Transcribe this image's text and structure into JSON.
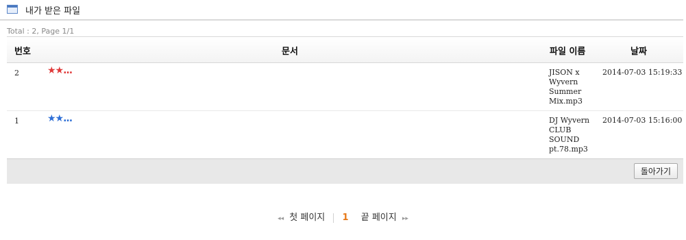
{
  "header": {
    "title": "내가 받은 파일",
    "icon": "window-icon"
  },
  "meta": {
    "total_text": "Total : 2, Page 1/1"
  },
  "table": {
    "columns": [
      "번호",
      "문서",
      "파일 이름",
      "날짜"
    ],
    "rows": [
      {
        "num": "2",
        "doc": "★★...",
        "doc_color": "#e03a3a",
        "file": "JISON x Wyvern Summer Mix.mp3",
        "date": "2014-07-03 15:19:33"
      },
      {
        "num": "1",
        "doc": "★★...",
        "doc_color": "#2f6fd6",
        "file": "DJ Wyvern CLUB SOUND pt.78.mp3",
        "date": "2014-07-03 15:16:00"
      }
    ]
  },
  "buttons": {
    "back_label": "돌아가기"
  },
  "pagination": {
    "first_label": "첫 페이지",
    "current": "1",
    "last_label": "끝 페이지"
  },
  "colors": {
    "accent": "#e77817"
  }
}
